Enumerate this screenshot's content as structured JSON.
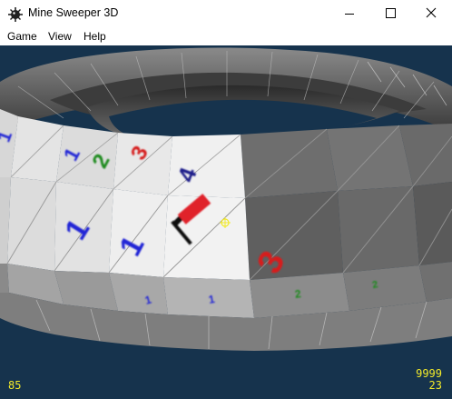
{
  "window": {
    "title": "Mine Sweeper 3D",
    "icon": "mine-icon"
  },
  "menu": {
    "items": [
      {
        "label": "Game"
      },
      {
        "label": "View"
      },
      {
        "label": "Help"
      }
    ]
  },
  "board": {
    "cell_numbers": {
      "edge_a": "1",
      "upper_1": "1",
      "upper_2": "2",
      "upper_3": "3",
      "upper_4": "4",
      "front_1": "1",
      "front_2": "1",
      "front_3": "3",
      "lower_1": "1",
      "lower_2": "1",
      "lower_3": "2",
      "lower_4": "2"
    },
    "number_colors": {
      "1": "#2326d6",
      "2": "#1a8a1a",
      "3": "#d61e1e",
      "4": "#1c1c8a"
    },
    "flag_icon": "flag-icon",
    "cursor_icon": "crosshair-cursor-icon"
  },
  "hud": {
    "time": "85",
    "counter_top": "9999",
    "counter_bottom": "23"
  },
  "colors": {
    "background": "#16334d",
    "hud_text": "#f2ea2a",
    "revealed_cell": "#e6e6e6",
    "covered_cell": "#7a7a7a"
  }
}
